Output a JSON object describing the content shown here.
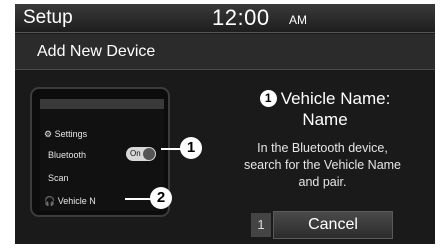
{
  "header": {
    "title": "Setup",
    "time": "12:00",
    "ampm": "AM"
  },
  "subheader": {
    "title": "Add New Device"
  },
  "phone": {
    "settings_label": "Settings",
    "bluetooth_label": "Bluetooth",
    "toggle_label": "On",
    "scan_label": "Scan",
    "vehicle_label": "Vehicle N"
  },
  "callouts": {
    "one": "1",
    "two": "2"
  },
  "info": {
    "number": "1",
    "heading_line1": "Vehicle Name:",
    "heading_line2": "Name",
    "body_line1": "In the Bluetooth device,",
    "body_line2": "search for the Vehicle Name",
    "body_line3": "and pair."
  },
  "softkey": {
    "number": "1",
    "cancel_label": "Cancel"
  }
}
